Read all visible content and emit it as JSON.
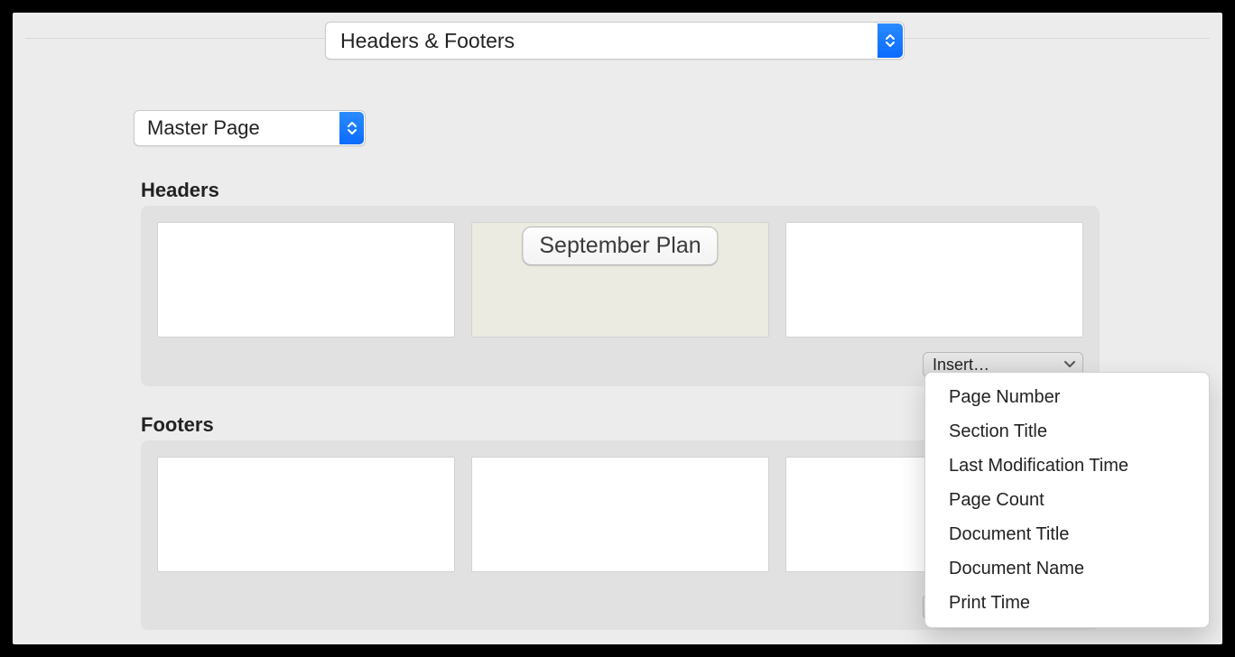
{
  "tabs": {
    "main": "Headers & Footers"
  },
  "page_select": "Master Page",
  "sections": {
    "headers": {
      "title": "Headers",
      "cells": {
        "left": "",
        "center_value": "September Plan",
        "right": ""
      }
    },
    "footers": {
      "title": "Footers",
      "cells": {
        "left": "",
        "center": "",
        "right": ""
      }
    }
  },
  "insert_label": "Insert…",
  "insert_menu": [
    "Page Number",
    "Section Title",
    "Last Modification Time",
    "Page Count",
    "Document Title",
    "Document Name",
    "Print Time"
  ]
}
